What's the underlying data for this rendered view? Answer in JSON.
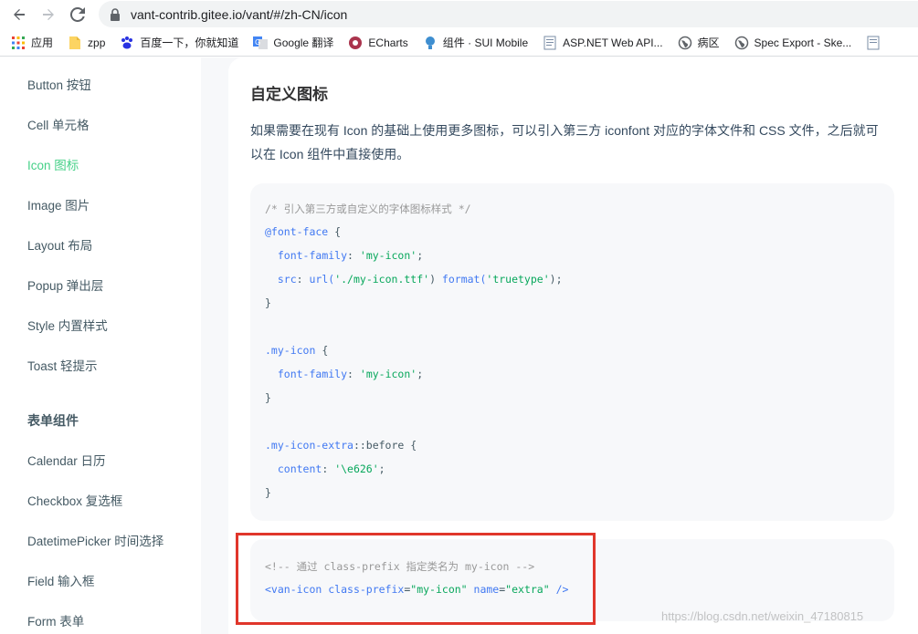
{
  "browser": {
    "url": "vant-contrib.gitee.io/vant/#/zh-CN/icon",
    "bookmarks": [
      {
        "label": "应用",
        "icon": "apps-grid-icon"
      },
      {
        "label": "zpp",
        "icon": "folder-icon"
      },
      {
        "label": "百度一下，你就知道",
        "icon": "baidu-paw-icon"
      },
      {
        "label": "Google 翻译",
        "icon": "google-translate-icon"
      },
      {
        "label": "ECharts",
        "icon": "echarts-icon"
      },
      {
        "label": "组件 · SUI Mobile",
        "icon": "bulb-icon"
      },
      {
        "label": "ASP.NET Web API...",
        "icon": "doc-icon"
      },
      {
        "label": "病区",
        "icon": "globe-icon"
      },
      {
        "label": "Spec Export - Ske...",
        "icon": "globe-icon"
      }
    ]
  },
  "sidebar": {
    "items": [
      {
        "label": "Button 按钮"
      },
      {
        "label": "Cell 单元格"
      },
      {
        "label": "Icon 图标"
      },
      {
        "label": "Image 图片"
      },
      {
        "label": "Layout 布局"
      },
      {
        "label": "Popup 弹出层"
      },
      {
        "label": "Style 内置样式"
      },
      {
        "label": "Toast 轻提示"
      }
    ],
    "group_title": "表单组件",
    "form_items": [
      {
        "label": "Calendar 日历"
      },
      {
        "label": "Checkbox 复选框"
      },
      {
        "label": "DatetimePicker 时间选择"
      },
      {
        "label": "Field 输入框"
      },
      {
        "label": "Form 表单"
      }
    ]
  },
  "content": {
    "title": "自定义图标",
    "paragraph": "如果需要在现有 Icon 的基础上使用更多图标，可以引入第三方 iconfont 对应的字体文件和 CSS 文件，之后就可以在 Icon 组件中直接使用。",
    "code1": {
      "comment": "/* 引入第三方或自定义的字体图标样式 */",
      "font_face": "@font-face",
      "open_brace": " {",
      "ff_prop": "font-family",
      "ff_val": "'my-icon'",
      "src_prop": "src",
      "src_url": "url(",
      "src_path": "'./my-icon.ttf'",
      "src_format": "format(",
      "src_type": "'truetype'",
      "close": "}",
      "sel_myicon": ".my-icon",
      "sel_extra": ".my-icon-extra",
      "pseudo": "::before",
      "content_prop": "content",
      "content_val": "'\\e626'"
    },
    "code2": {
      "comment": "<!-- 通过 class-prefix 指定类名为 my-icon -->",
      "tag_open": "<van-icon",
      "attr1": "class-prefix",
      "val1": "\"my-icon\"",
      "attr2": "name",
      "val2": "\"extra\"",
      "tag_close": "/>"
    }
  },
  "watermark": "https://blog.csdn.net/weixin_47180815"
}
